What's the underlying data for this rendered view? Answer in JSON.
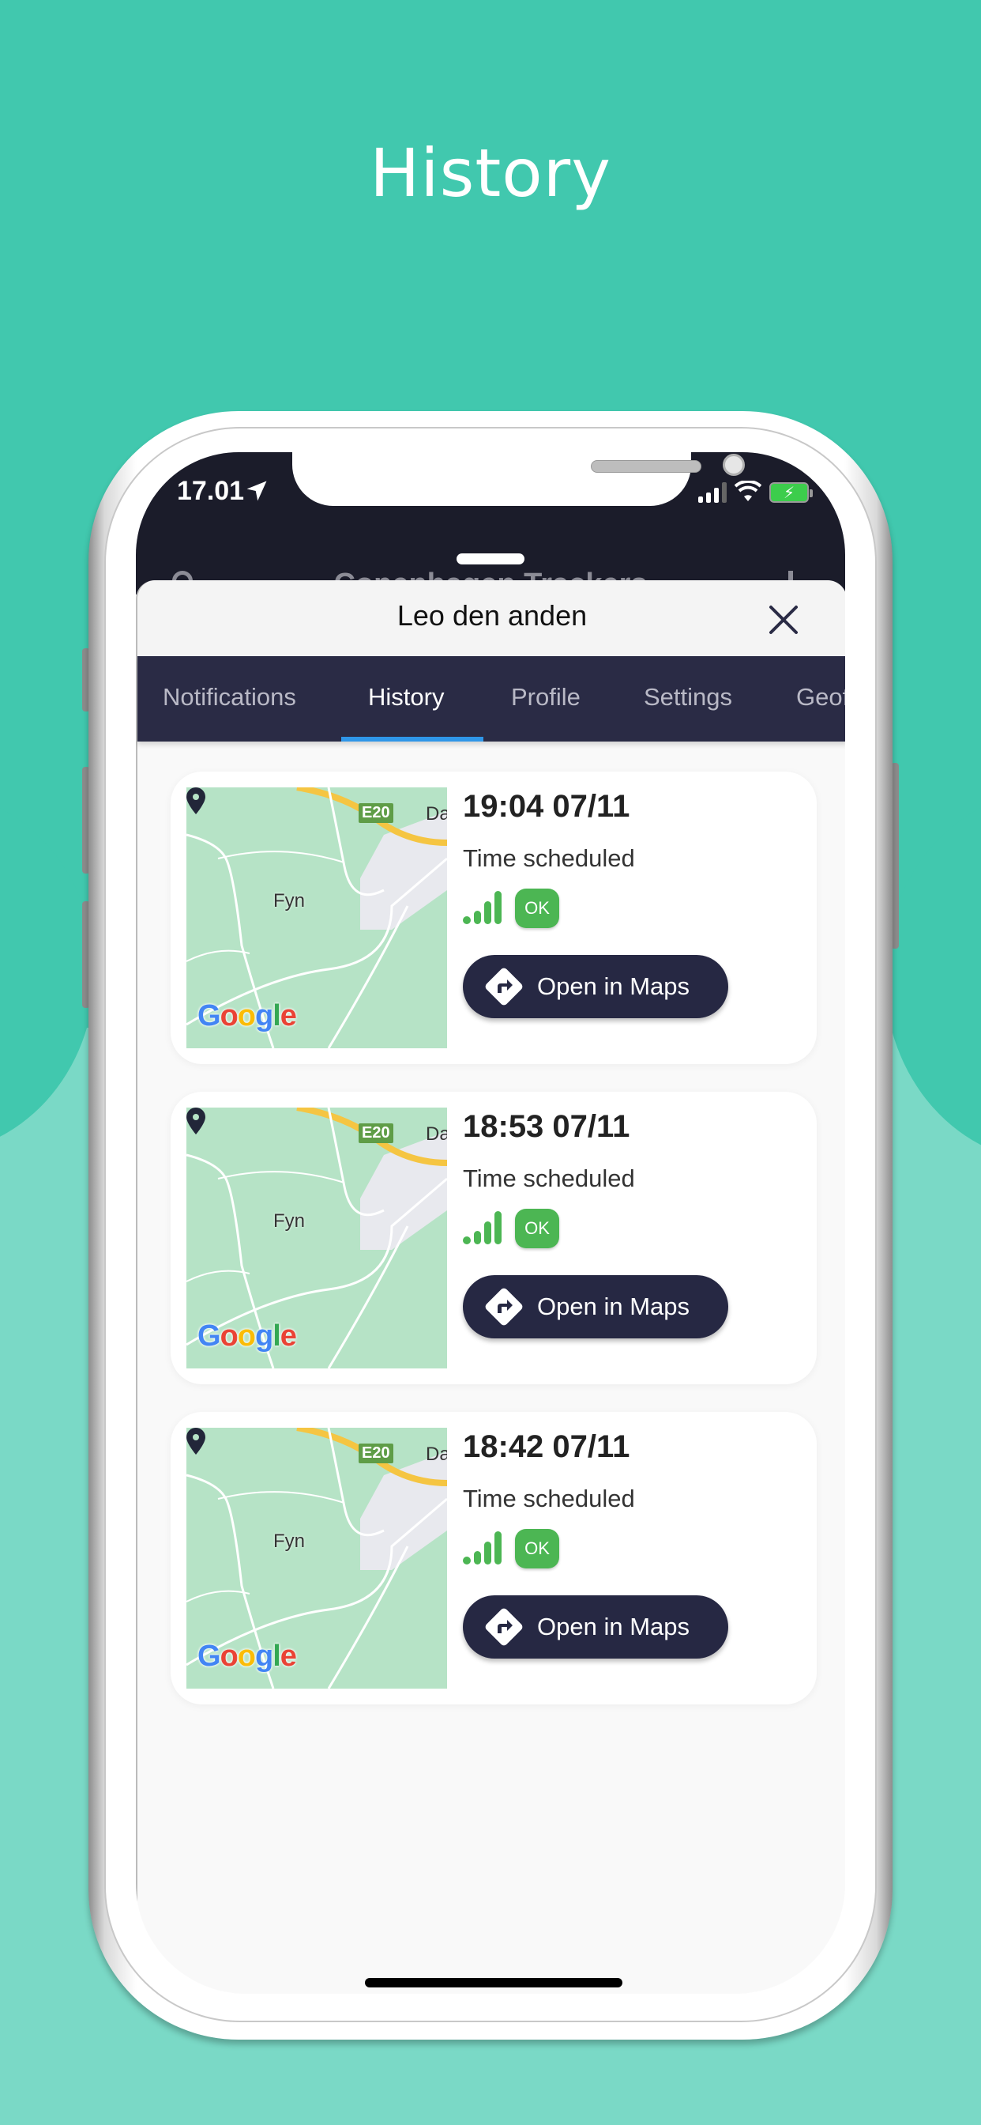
{
  "page": {
    "heading": "History"
  },
  "status_bar": {
    "time": "17.01",
    "location_icon": "location-arrow-icon",
    "signal_icon": "cellular-signal-icon",
    "wifi_icon": "wifi-icon",
    "battery_icon": "battery-charging-icon"
  },
  "background_app": {
    "title": "Copenhagen Trackers"
  },
  "sheet": {
    "title": "Leo den anden",
    "close_icon": "close-icon"
  },
  "tabs": [
    {
      "label": "Notifications",
      "active": false
    },
    {
      "label": "History",
      "active": true
    },
    {
      "label": "Profile",
      "active": false
    },
    {
      "label": "Settings",
      "active": false
    },
    {
      "label": "Geof",
      "active": false
    }
  ],
  "colors": {
    "background_teal": "#41c8ae",
    "background_light_teal": "#7ad9c6",
    "tab_bar": "#2a2b45",
    "tab_indicator": "#2f96e8",
    "button_dark": "#262843",
    "ok_green": "#4cb653"
  },
  "history": [
    {
      "time": "19:04 07/11",
      "trigger": "Time scheduled",
      "signal_icon": "signal-strength-icon",
      "status": "OK",
      "button_label": "Open in Maps",
      "button_icon": "directions-icon",
      "map": {
        "place_label": "Fyn",
        "road_label": "E20",
        "city_label": "Da",
        "attribution": "Google"
      }
    },
    {
      "time": "18:53 07/11",
      "trigger": "Time scheduled",
      "signal_icon": "signal-strength-icon",
      "status": "OK",
      "button_label": "Open in Maps",
      "button_icon": "directions-icon",
      "map": {
        "place_label": "Fyn",
        "road_label": "E20",
        "city_label": "Da",
        "attribution": "Google"
      }
    },
    {
      "time": "18:42 07/11",
      "trigger": "Time scheduled",
      "signal_icon": "signal-strength-icon",
      "status": "OK",
      "button_label": "Open in Maps",
      "button_icon": "directions-icon",
      "map": {
        "place_label": "Fyn",
        "road_label": "E20",
        "city_label": "Da",
        "attribution": "Google"
      }
    }
  ]
}
